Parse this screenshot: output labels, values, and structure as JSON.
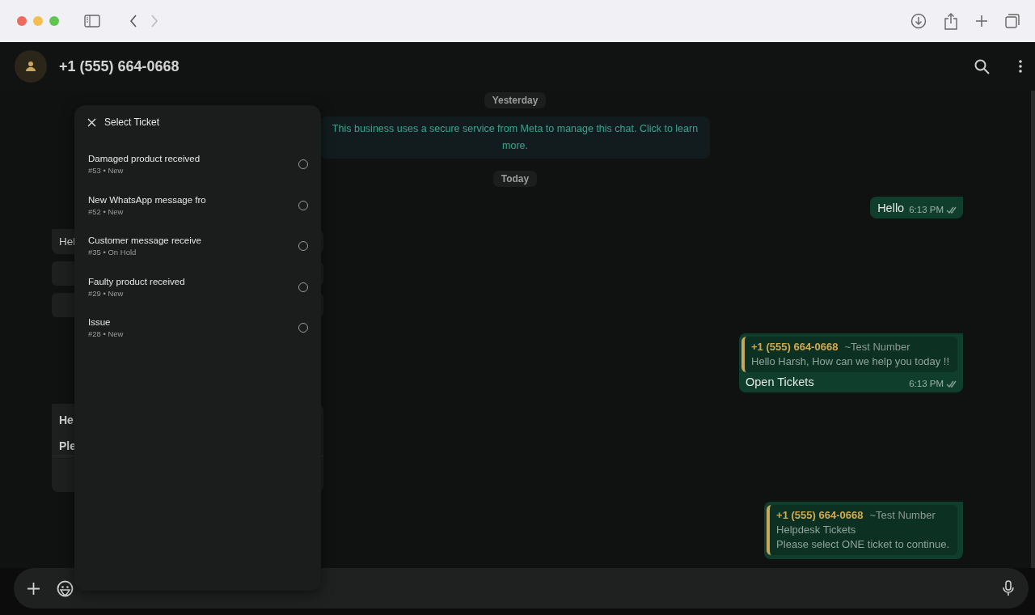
{
  "browser": {
    "back_enabled": true,
    "forward_enabled": false
  },
  "chat": {
    "contact": "+1 (555) 664-0668"
  },
  "messages": [
    {
      "kind": "date",
      "text": "Yesterday"
    },
    {
      "kind": "system",
      "text": "This business uses a secure service from Meta to manage this chat. Click to learn more."
    },
    {
      "kind": "date",
      "text": "Today"
    },
    {
      "kind": "out",
      "text": "Hello",
      "time": "6:13 PM"
    },
    {
      "kind": "in",
      "lines": [
        "Hel"
      ],
      "buttons": [
        {
          "kind": "quick_reply"
        },
        {
          "kind": "quick_reply"
        }
      ]
    },
    {
      "kind": "reply",
      "quote_sender": "+1 (555) 664-0668",
      "quote_name": "~Test Number",
      "quote_lines": [
        "Hello Harsh, How can we help you today !!"
      ],
      "text": "Open Tickets",
      "time": "6:13 PM"
    },
    {
      "kind": "in",
      "lines": [
        "He",
        "Ple"
      ],
      "footer": true
    },
    {
      "kind": "reply",
      "quote_sender": "+1 (555) 664-0668",
      "quote_name": "~Test Number",
      "quote_lines": [
        "Helpdesk Tickets",
        "Please select ONE ticket to continue."
      ]
    }
  ],
  "ticket_picker": {
    "title": "Select Ticket",
    "tickets": [
      {
        "title": "Damaged product received",
        "meta": "#53 • New",
        "selected": false
      },
      {
        "title": "New WhatsApp message fro",
        "meta": "#52 • New",
        "selected": false
      },
      {
        "title": "Customer message receive",
        "meta": "#35 • On Hold",
        "selected": false
      },
      {
        "title": "Faulty product received",
        "meta": "#29 • New",
        "selected": false
      },
      {
        "title": "Issue",
        "meta": "#28 • New",
        "selected": false
      }
    ]
  }
}
